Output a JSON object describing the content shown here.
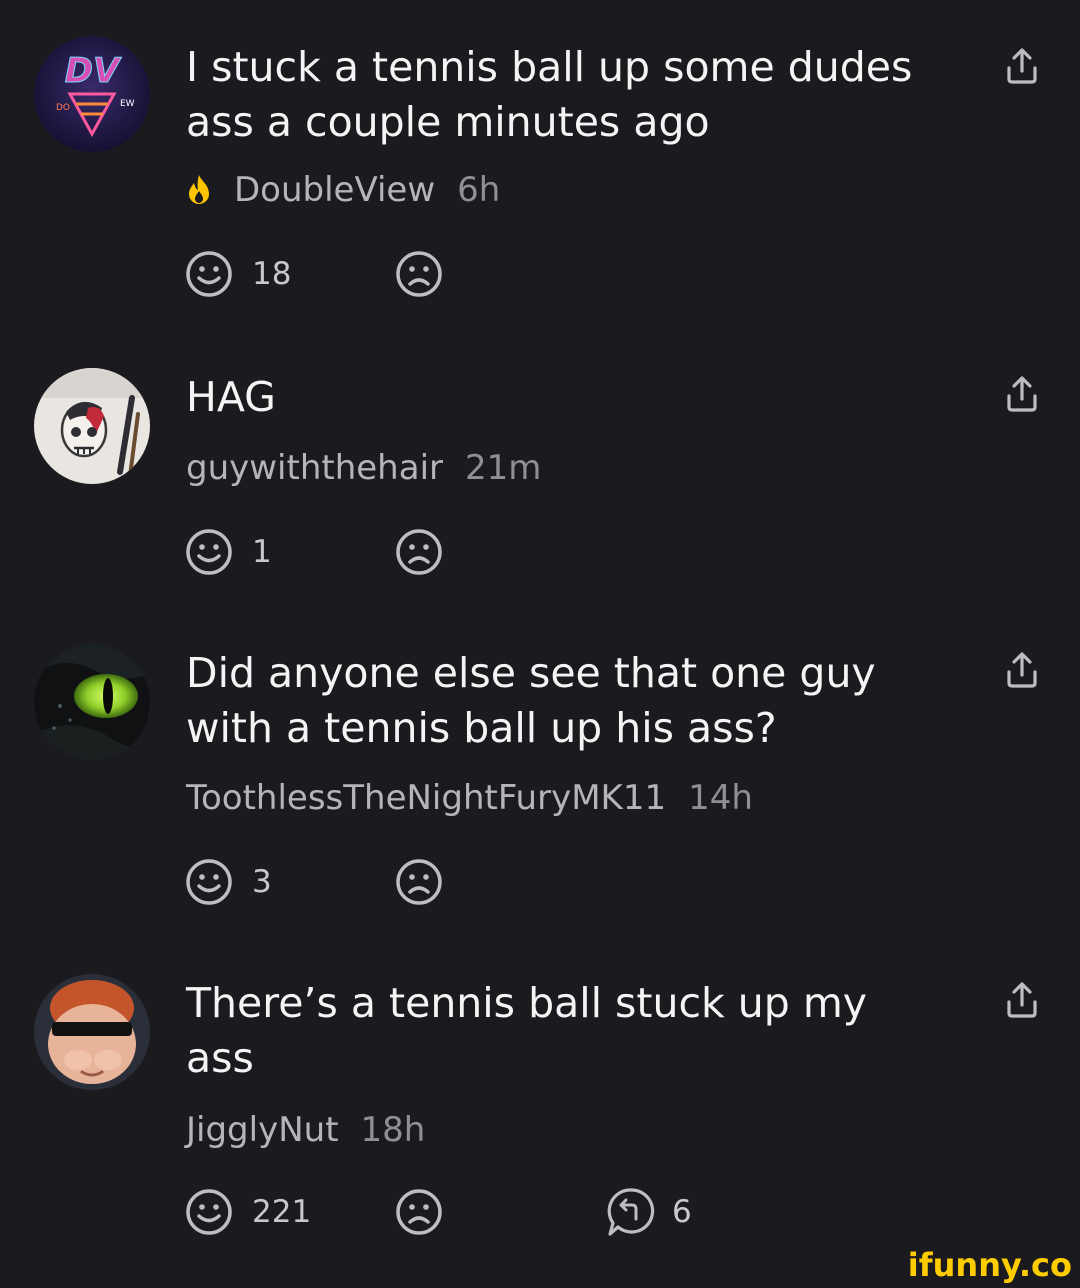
{
  "comments": [
    {
      "text": "I stuck a tennis ball up some dudes ass a couple minutes ago",
      "username": "DoubleView",
      "time": "6h",
      "smiles": "18",
      "avatar": "doubleview-avatar",
      "badge": "flame-icon"
    },
    {
      "text": "HAG",
      "username": "guywiththehair",
      "time": "21m",
      "smiles": "1",
      "avatar": "skull-sketch-avatar"
    },
    {
      "text": "Did anyone else see that one guy with a tennis ball up his ass?",
      "username": "ToothlessTheNightFuryMK11",
      "time": "14h",
      "smiles": "3",
      "avatar": "dragon-eye-avatar"
    },
    {
      "text": "There’s a tennis ball stuck up my ass",
      "username": "JigglyNut",
      "time": "18h",
      "smiles": "221",
      "replies": "6",
      "avatar": "cartoon-kid-avatar"
    }
  ],
  "colors": {
    "background": "#1b1b1f",
    "text": "#f4f4f4",
    "meta": "#a0a0a6",
    "icon": "#bdbdc2",
    "flame": "#ffc400",
    "watermark": "#ffcc00"
  },
  "watermark": "ifunny.co"
}
